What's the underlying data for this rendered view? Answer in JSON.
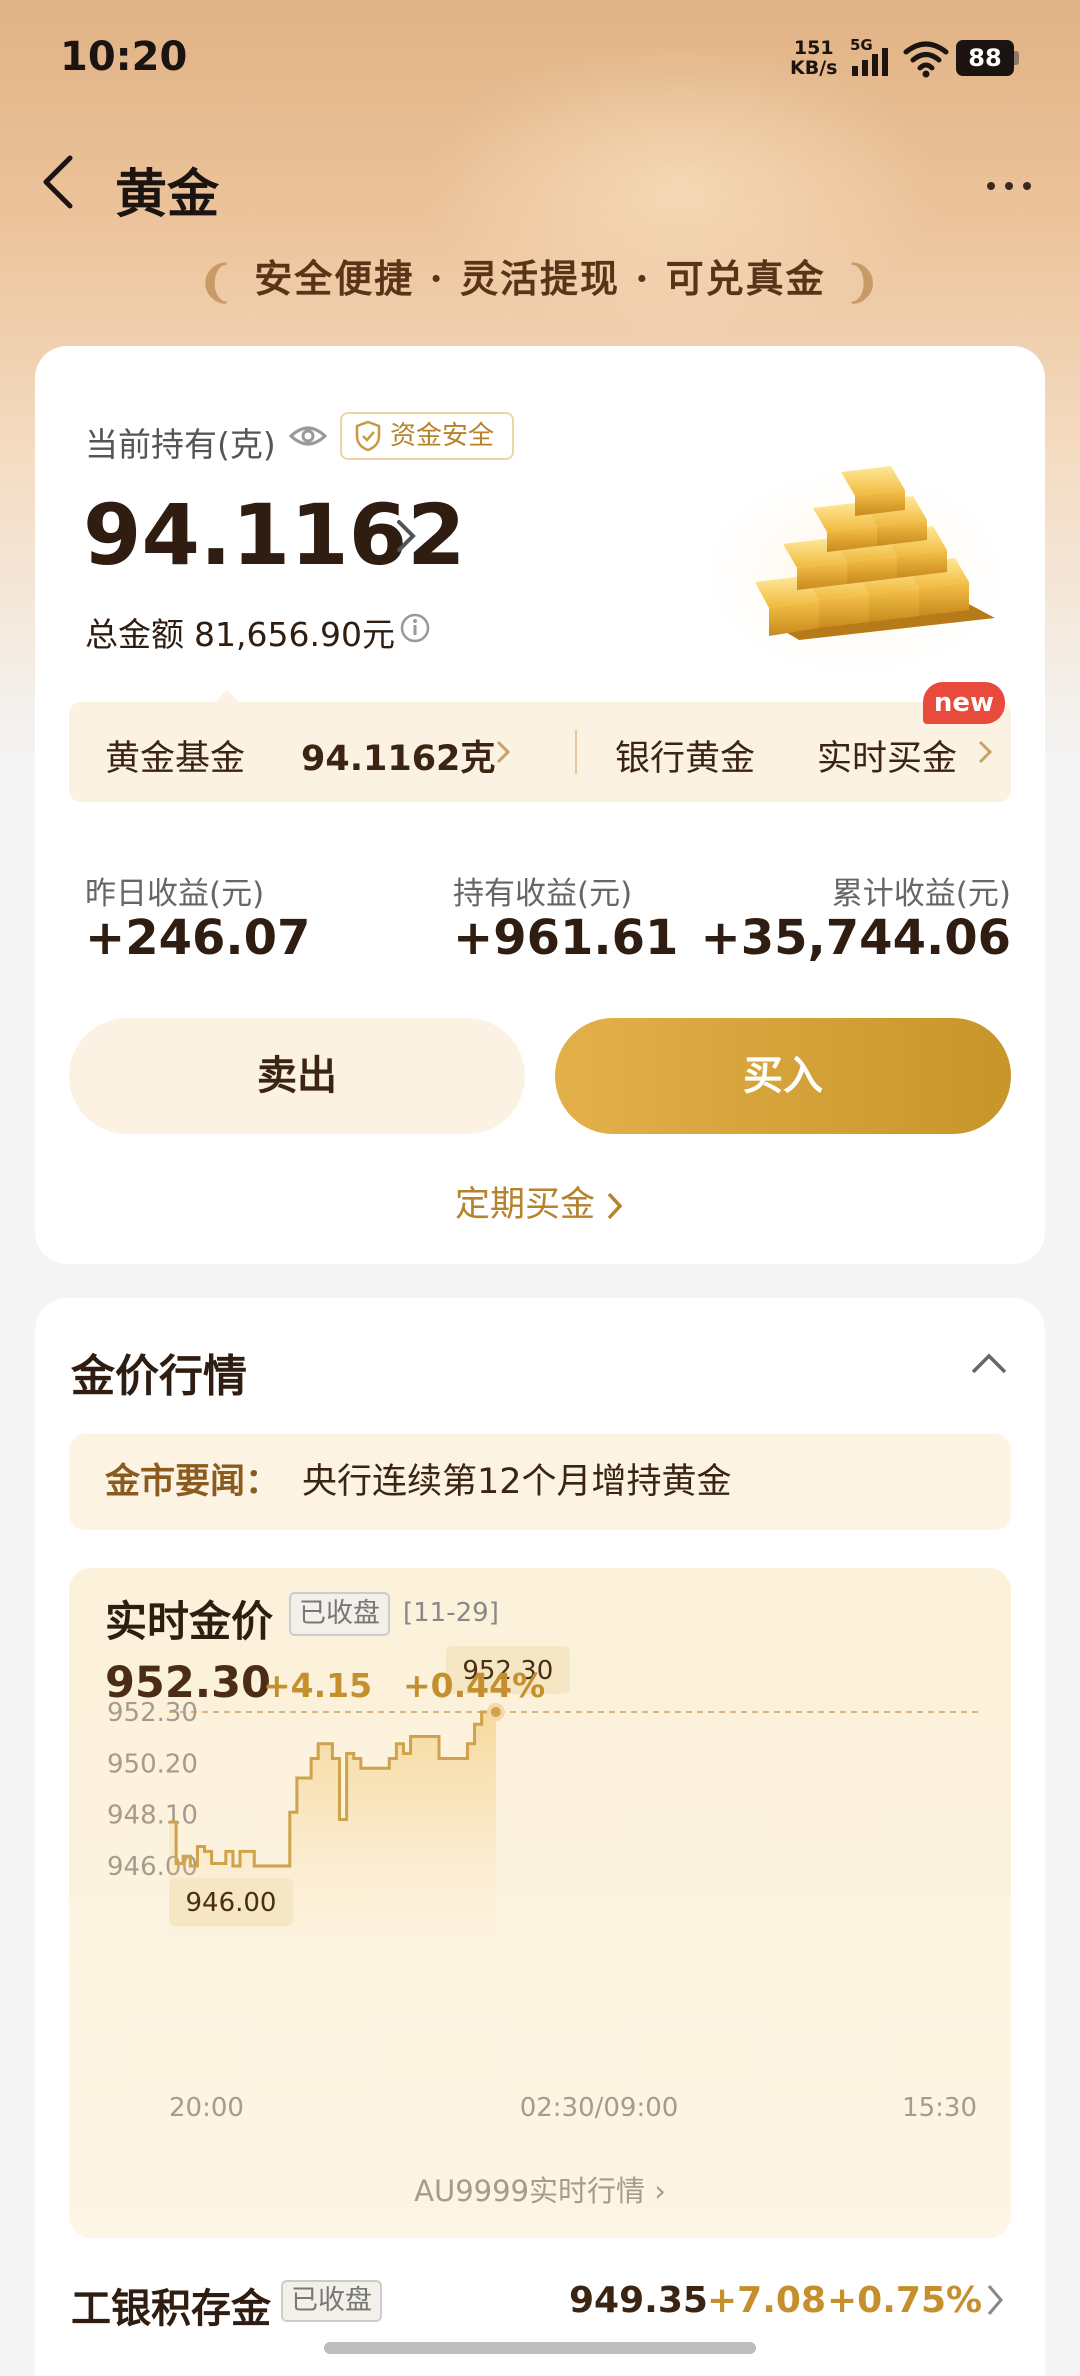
{
  "status_bar": {
    "time": "10:20",
    "net_speed_value": "151",
    "net_speed_unit": "KB/s",
    "network": "5G",
    "battery": "88"
  },
  "header": {
    "title": "黄金",
    "slogan": "安全便捷 · 灵活提现 · 可兑真金"
  },
  "holdings": {
    "label": "当前持有(克)",
    "safe_badge": "资金安全",
    "grams": "94.1162",
    "total_label": "总金额",
    "total_value": "81,656.90元",
    "tabs": [
      {
        "label": "黄金基金",
        "value": "94.1162克"
      },
      {
        "label": "银行黄金",
        "value": ""
      },
      {
        "label": "实时买金",
        "value": ""
      }
    ],
    "new_badge": "new",
    "stats": [
      {
        "label": "昨日收益(元)",
        "value": "+246.07"
      },
      {
        "label": "持有收益(元)",
        "value": "+961.61"
      },
      {
        "label": "累计收益(元)",
        "value": "+35,744.06"
      }
    ],
    "sell_label": "卖出",
    "buy_label": "买入",
    "periodic_label": "定期买金"
  },
  "market": {
    "title": "金价行情",
    "news_label": "金市要闻：",
    "news_text": "央行连续第12个月增持黄金",
    "chart_title": "实时金价",
    "closed_badge": "已收盘",
    "date": "[11-29]",
    "price": "952.30",
    "change": "+4.15",
    "change_pct": "+0.44%",
    "link_label": "AU9999实时行情",
    "bank": {
      "name": "工银积存金",
      "badge": "已收盘",
      "price": "949.35",
      "change": "+7.08",
      "change_pct": "+0.75%"
    }
  },
  "colors": {
    "accent_gold": "#c8952a",
    "price_up": "#c48f2c",
    "new_badge": "#e84b3c"
  },
  "chart_data": {
    "type": "line",
    "title": "实时金价",
    "yticks": [
      "952.30",
      "950.20",
      "948.10",
      "946.00"
    ],
    "xticks": [
      "20:00",
      "02:30/09:00",
      "15:30"
    ],
    "ylim": [
      946.0,
      952.3
    ],
    "grid": false,
    "high_label": "952.30",
    "low_label": "946.00",
    "reference_line": 952.3,
    "points": [
      [
        0,
        947.8
      ],
      [
        1,
        946.1
      ],
      [
        2,
        946.4
      ],
      [
        3,
        946.0
      ],
      [
        4,
        946.8
      ],
      [
        5,
        946.6
      ],
      [
        6,
        946.1
      ],
      [
        7,
        946.1
      ],
      [
        8,
        946.6
      ],
      [
        9,
        946.0
      ],
      [
        10,
        946.6
      ],
      [
        11,
        946.6
      ],
      [
        12,
        946.0
      ],
      [
        13,
        946.0
      ],
      [
        14,
        946.0
      ],
      [
        15,
        946.0
      ],
      [
        16,
        946.0
      ],
      [
        17,
        948.2
      ],
      [
        18,
        949.6
      ],
      [
        19,
        949.6
      ],
      [
        20,
        950.4
      ],
      [
        21,
        951.0
      ],
      [
        22,
        951.0
      ],
      [
        23,
        950.4
      ],
      [
        24,
        947.9
      ],
      [
        25,
        950.6
      ],
      [
        26,
        950.4
      ],
      [
        27,
        950.0
      ],
      [
        28,
        950.0
      ],
      [
        29,
        950.0
      ],
      [
        30,
        950.0
      ],
      [
        31,
        950.4
      ],
      [
        32,
        951.0
      ],
      [
        33,
        950.6
      ],
      [
        34,
        951.3
      ],
      [
        35,
        951.3
      ],
      [
        36,
        951.3
      ],
      [
        37,
        951.3
      ],
      [
        38,
        950.4
      ],
      [
        39,
        950.4
      ],
      [
        40,
        950.4
      ],
      [
        41,
        950.4
      ],
      [
        42,
        951.0
      ],
      [
        43,
        951.8
      ],
      [
        44,
        952.3
      ],
      [
        45,
        952.3
      ],
      [
        46,
        952.3
      ]
    ],
    "x_total": 115
  }
}
